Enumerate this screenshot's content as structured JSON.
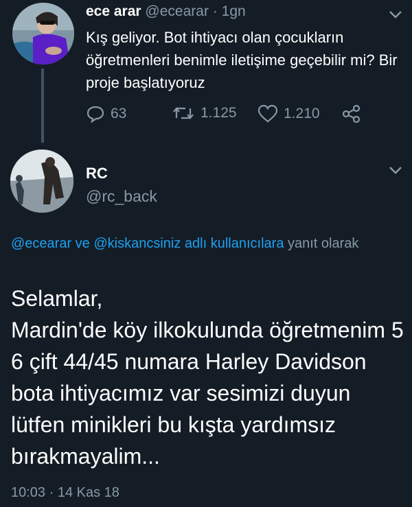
{
  "tweet1": {
    "name": "ece arar",
    "handle": "@ecearar",
    "separator": "·",
    "time": "1gn",
    "text": "Kış geliyor. Bot ihtiyacı olan çocukların öğretmenleri benimle iletişime geçebilir mi? Bir proje başlatıyoruz",
    "replies": "63",
    "retweets": "1.125",
    "likes": "1.210",
    "icons": [
      "reply-icon",
      "retweet-icon",
      "like-icon",
      "share-icon",
      "chevron-down-icon"
    ]
  },
  "tweet2": {
    "name": "RC",
    "handle": "@rc_back",
    "reply_prefix_mentions": "@ecearar ve @kiskancsiniz",
    "reply_suffix": " adlı kullanıcılara",
    "reply_tail": " yanıt olarak",
    "text": "Selamlar,\nMardin'de köy ilkokulunda öğretmenim 5 6 çift 44/45 numara Harley Davidson bota ihtiyacımız var sesimizi duyun lütfen minikleri bu kışta yardımsız bırakmayalim...",
    "timestamp": "10:03 · 14 Kas 18"
  },
  "colors": {
    "background": "#141d26",
    "text": "#ffffff",
    "muted": "#8899a6",
    "link": "#1da1f2",
    "thread_line": "#3d5466"
  }
}
